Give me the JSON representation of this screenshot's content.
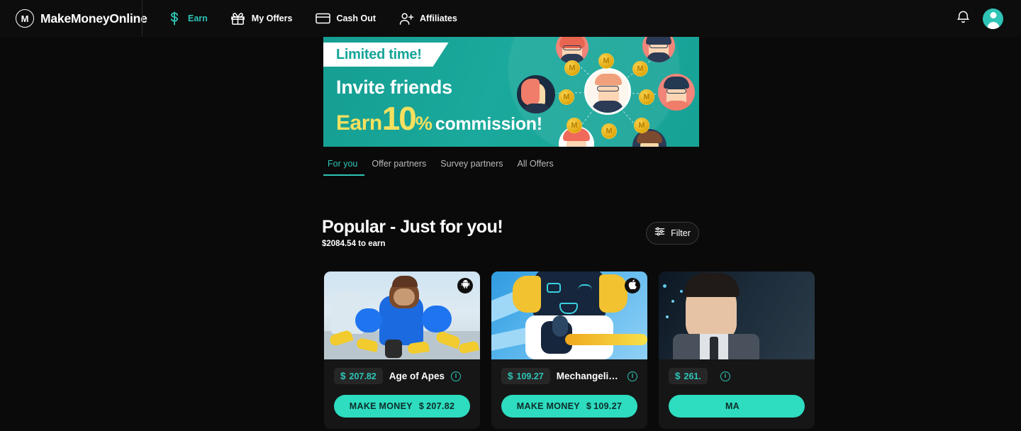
{
  "navbar": {
    "brand": {
      "mark": "M",
      "name": "MakeMoneyOnline"
    },
    "links": [
      {
        "label": "Earn",
        "icon": "dollar-icon",
        "active": true
      },
      {
        "label": "My Offers",
        "icon": "gift-icon",
        "active": false
      },
      {
        "label": "Cash Out",
        "icon": "credit-card-icon",
        "active": false
      },
      {
        "label": "Affiliates",
        "icon": "user-plus-icon",
        "active": false
      }
    ],
    "notifications_icon": "bell-icon",
    "avatar_icon": "user-avatar-icon"
  },
  "banner": {
    "ribbon": "Limited time!",
    "line1": "Invite friends",
    "earn_word": "Earn",
    "percent_number": "10",
    "percent_symbol": "%",
    "commission_word": "commission!",
    "coin_glyph": "M"
  },
  "tabs": [
    {
      "label": "For you",
      "active": true
    },
    {
      "label": "Offer partners",
      "active": false
    },
    {
      "label": "Survey partners",
      "active": false
    },
    {
      "label": "All Offers",
      "active": false
    }
  ],
  "filter": {
    "label": "Filter",
    "icon": "sliders-icon"
  },
  "section": {
    "title": "Popular - Just for you!",
    "subtitle": "$2084.54 to earn"
  },
  "cards": [
    {
      "title": "Age of Apes",
      "price_symbol": "$",
      "price": "207.82",
      "platform": "android-icon",
      "cta_label": "MAKE MONEY",
      "cta_symbol": "$",
      "cta_amount": "207.82",
      "info_icon": "info-icon",
      "art": "art-apes"
    },
    {
      "title": "Mechangelio...",
      "price_symbol": "$",
      "price": "109.27",
      "platform": "apple-icon",
      "cta_label": "MAKE MONEY",
      "cta_symbol": "$",
      "cta_amount": "109.27",
      "info_icon": "info-icon",
      "art": "art-mech"
    },
    {
      "title": "",
      "price_symbol": "$",
      "price": "261.",
      "platform": "",
      "cta_label": "MA",
      "cta_symbol": "",
      "cta_amount": "",
      "info_icon": "info-icon",
      "art": "art-man"
    }
  ],
  "colors": {
    "accent_teal": "#2ec4b6",
    "cta_teal": "#2edcc0",
    "banner_green": "#16a598",
    "banner_yellow": "#f6e05e",
    "page_bg": "#0a0a0a",
    "card_bg": "#161616"
  }
}
